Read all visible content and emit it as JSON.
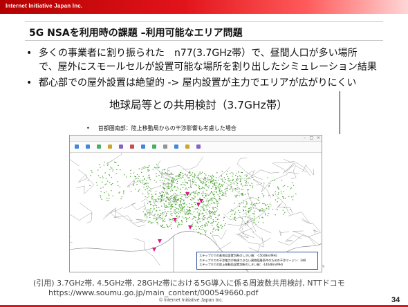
{
  "header": {
    "brand": "Internet Initiative Japan Inc."
  },
  "slide": {
    "title": "5G NSAを利用時の課題 –利用可能なエリア問題",
    "bullet_symbol": "•",
    "bullets": [
      {
        "line1": "多くの事業者に割り振られた　n77(3.7GHz帯）で、昼間人口が多い場所",
        "line2": "で、屋外にスモールセルが設置可能な場所を割り出したシミュレーション結果"
      },
      {
        "line1": "都心部での屋外設置は絶望的 -> 屋内設置が主力でエリアが広がりにくい"
      }
    ],
    "subheading": "地球局等との共用検討（3.7GHz帯）"
  },
  "figure": {
    "bullet": "首都圏南部：陸上移動局からの干渉影響も考慮した場合",
    "accent_color": "#e0148a",
    "land_color": "#52a83a",
    "legend": [
      "ステップ①での基地局設置判断のしきい値：-150dBm/MHz",
      "ステップ②での干渉電力が無視できない建物距離条件のための干渉マージン：3dB",
      "ステップ③での陸上移動局設置判断のしきい値：-140dBm/MHz"
    ],
    "scroll_note": "9"
  },
  "citation": {
    "line1": "(引用) 3.7GHz帯, 4.5GHz帯, 28GHz帯における5G導入に係る周波数共用検討, NTTドコモ",
    "line2": "https://www.soumu.go.jp/main_content/000549660.pdf"
  },
  "footer": {
    "copyright": "© Internet Initiative Japan Inc.",
    "page_number": "34"
  }
}
